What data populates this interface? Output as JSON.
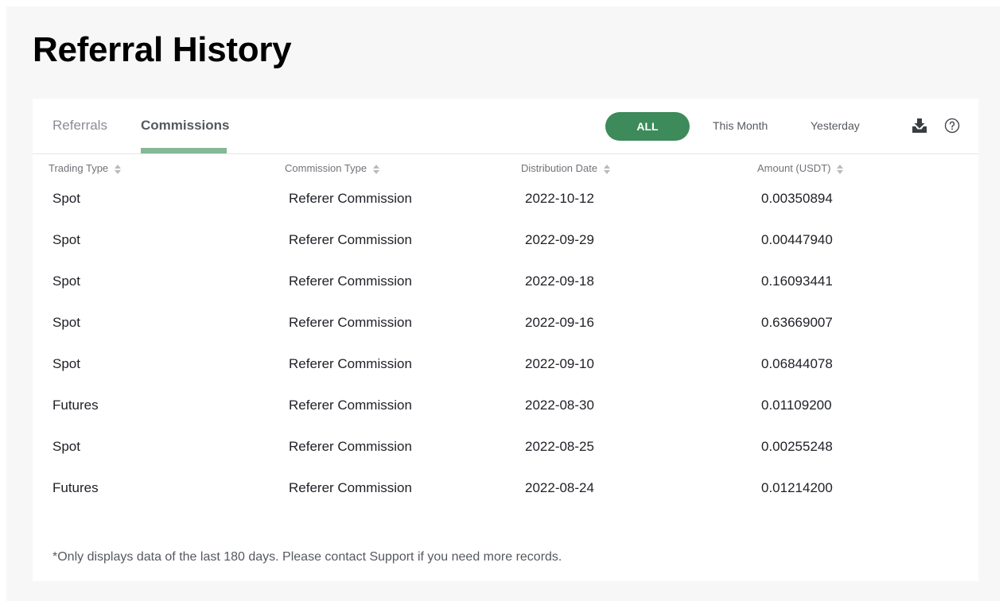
{
  "page": {
    "title": "Referral History"
  },
  "tabs": [
    {
      "label": "Referrals",
      "active": false
    },
    {
      "label": "Commissions",
      "active": true
    }
  ],
  "filters": {
    "all": "ALL",
    "this_month": "This Month",
    "yesterday": "Yesterday",
    "selected": "ALL"
  },
  "toolbar_icons": [
    "download-icon",
    "help-icon"
  ],
  "colors": {
    "accent": "#3d8a5a",
    "tab_underline": "#85b898"
  },
  "table": {
    "columns": [
      "Trading Type",
      "Commission Type",
      "Distribution Date",
      "Amount (USDT)"
    ],
    "rows": [
      [
        "Spot",
        "Referer Commission",
        "2022-10-12",
        "0.00350894"
      ],
      [
        "Spot",
        "Referer Commission",
        "2022-09-29",
        "0.00447940"
      ],
      [
        "Spot",
        "Referer Commission",
        "2022-09-18",
        "0.16093441"
      ],
      [
        "Spot",
        "Referer Commission",
        "2022-09-16",
        "0.63669007"
      ],
      [
        "Spot",
        "Referer Commission",
        "2022-09-10",
        "0.06844078"
      ],
      [
        "Futures",
        "Referer Commission",
        "2022-08-30",
        "0.01109200"
      ],
      [
        "Spot",
        "Referer Commission",
        "2022-08-25",
        "0.00255248"
      ],
      [
        "Futures",
        "Referer Commission",
        "2022-08-24",
        "0.01214200"
      ]
    ]
  },
  "footnote": "*Only displays data of the last 180 days. Please contact Support if you need more records."
}
